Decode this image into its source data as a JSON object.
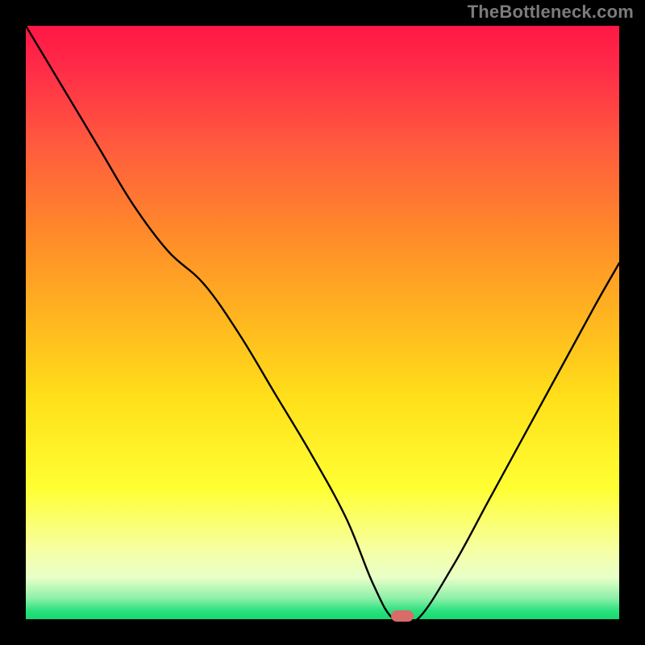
{
  "watermark": "TheBottleneck.com",
  "colors": {
    "frame": "#000000",
    "watermark": "#7c7c7c",
    "curve": "#000000",
    "marker": "#d96b6b",
    "gradient_stops": [
      {
        "offset": 0.0,
        "color": "#ff1744"
      },
      {
        "offset": 0.07,
        "color": "#ff2b48"
      },
      {
        "offset": 0.2,
        "color": "#ff5a3e"
      },
      {
        "offset": 0.35,
        "color": "#ff8a2a"
      },
      {
        "offset": 0.5,
        "color": "#ffb81f"
      },
      {
        "offset": 0.63,
        "color": "#ffe01a"
      },
      {
        "offset": 0.78,
        "color": "#ffff33"
      },
      {
        "offset": 0.88,
        "color": "#f7ffa0"
      },
      {
        "offset": 0.93,
        "color": "#e8ffc8"
      },
      {
        "offset": 0.965,
        "color": "#8cf0a8"
      },
      {
        "offset": 0.985,
        "color": "#2ee27f"
      },
      {
        "offset": 1.0,
        "color": "#18d66f"
      }
    ]
  },
  "chart_data": {
    "type": "line",
    "title": "",
    "xlabel": "",
    "ylabel": "",
    "xlim": [
      0,
      1
    ],
    "ylim": [
      0,
      1
    ],
    "grid": false,
    "series": [
      {
        "name": "bottleneck-curve",
        "x": [
          0.0,
          0.06,
          0.12,
          0.18,
          0.24,
          0.3,
          0.36,
          0.42,
          0.48,
          0.54,
          0.585,
          0.62,
          0.66,
          0.72,
          0.78,
          0.84,
          0.9,
          0.96,
          1.0
        ],
        "y": [
          1.0,
          0.9,
          0.8,
          0.7,
          0.62,
          0.565,
          0.48,
          0.38,
          0.28,
          0.17,
          0.06,
          0.0,
          0.0,
          0.09,
          0.2,
          0.31,
          0.42,
          0.53,
          0.6
        ]
      }
    ],
    "marker": {
      "x": 0.635,
      "y": 0.005
    },
    "notes": "Axes are normalized 0..1; background is a vertical red→green gradient indicating bottleneck severity (red=high, green=low). Curve is the black V-shape reaching 0 near x≈0.62–0.66; small rounded marker sits at the minimum."
  }
}
